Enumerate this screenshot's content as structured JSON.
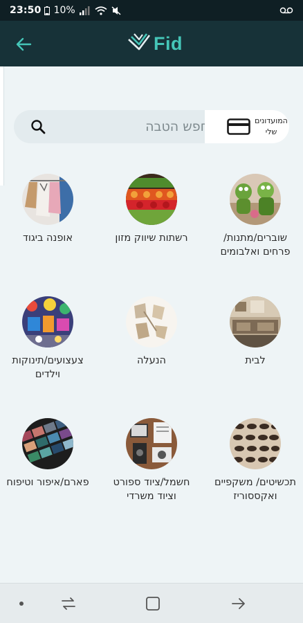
{
  "status_bar": {
    "time": "23:50",
    "battery": "10%"
  },
  "header": {
    "logo_text": "Fid"
  },
  "search": {
    "placeholder": "חפש הטבה",
    "clubs_label": "המועדונים שלי"
  },
  "categories": [
    {
      "label": "שוברים/מתנות/ פרחים ואלבומים",
      "image": "frogs-figurines"
    },
    {
      "label": "רשתות שיווק מזון",
      "image": "fruit-stand"
    },
    {
      "label": "אופנה ביגוד",
      "image": "clothes-rack"
    },
    {
      "label": "לבית",
      "image": "living-room"
    },
    {
      "label": "הנעלה",
      "image": "shoes"
    },
    {
      "label": "צעצועים/תינוקות וילדים",
      "image": "toys"
    },
    {
      "label": "תכשיטים/ משקפיים ואקססוריז",
      "image": "sunglasses-rack"
    },
    {
      "label": "חשמל/ציוד ספורט וציוד משרדי",
      "image": "electronics-desk"
    },
    {
      "label": "פארם/איפור וטיפוח",
      "image": "eyeshadow-palette"
    }
  ],
  "colors": {
    "header_bg": "#173238",
    "accent": "#45c6b8",
    "background": "#eef4f6"
  }
}
